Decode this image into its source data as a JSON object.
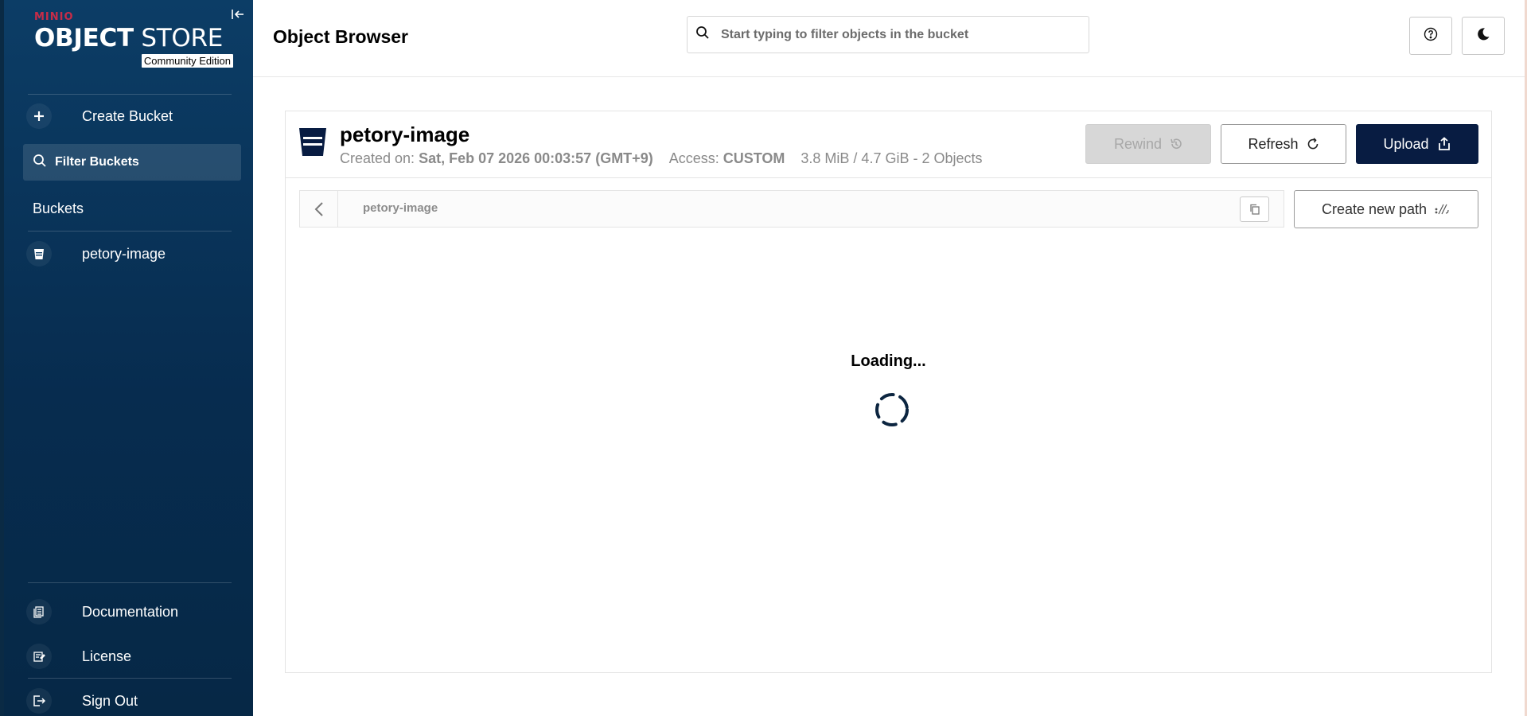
{
  "sidebar": {
    "brand": "MINIO",
    "product_bold": "OBJECT",
    "product_light": " STORE",
    "edition": "Community Edition",
    "create_bucket": "Create Bucket",
    "filter_placeholder": "Filter Buckets",
    "section_title": "Buckets",
    "buckets": [
      {
        "label": "petory-image"
      }
    ],
    "footer": {
      "documentation": "Documentation",
      "license": "License",
      "sign_out": "Sign Out"
    }
  },
  "header": {
    "title": "Object Browser",
    "search_placeholder": "Start typing to filter objects in the bucket"
  },
  "bucket": {
    "name": "petory-image",
    "created_label": "Created on: ",
    "created_value": "Sat, Feb 07 2026 00:03:57 (GMT+9)",
    "access_label": "Access: ",
    "access_value": "CUSTOM",
    "usage": "3.8 MiB / 4.7 GiB - 2 Objects"
  },
  "actions": {
    "rewind": "Rewind",
    "refresh": "Refresh",
    "upload": "Upload",
    "create_path": "Create new path"
  },
  "path": {
    "current": "petory-image"
  },
  "status": {
    "loading": "Loading..."
  },
  "colors": {
    "sidebar_bg": "#0c3d66",
    "brand_red": "#c72c48",
    "primary_button": "#081c42"
  }
}
